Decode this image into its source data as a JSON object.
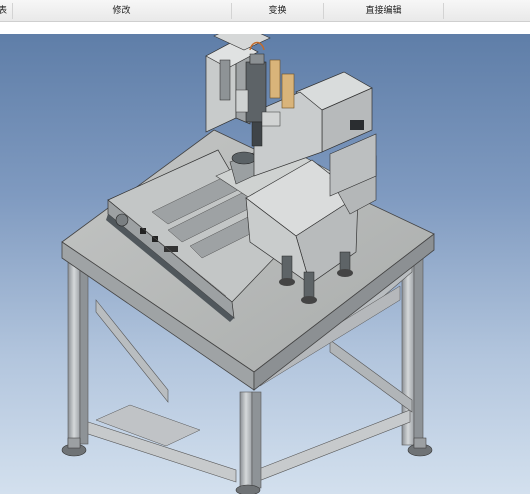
{
  "toolbar": {
    "tabs": [
      {
        "label": "表"
      },
      {
        "label": "修改"
      },
      {
        "label": "变换"
      },
      {
        "label": "直接编辑"
      }
    ]
  },
  "viewport": {
    "model": "machine-assembly",
    "background_top": "#5f7ea8",
    "background_bottom": "#d3e0ee"
  }
}
